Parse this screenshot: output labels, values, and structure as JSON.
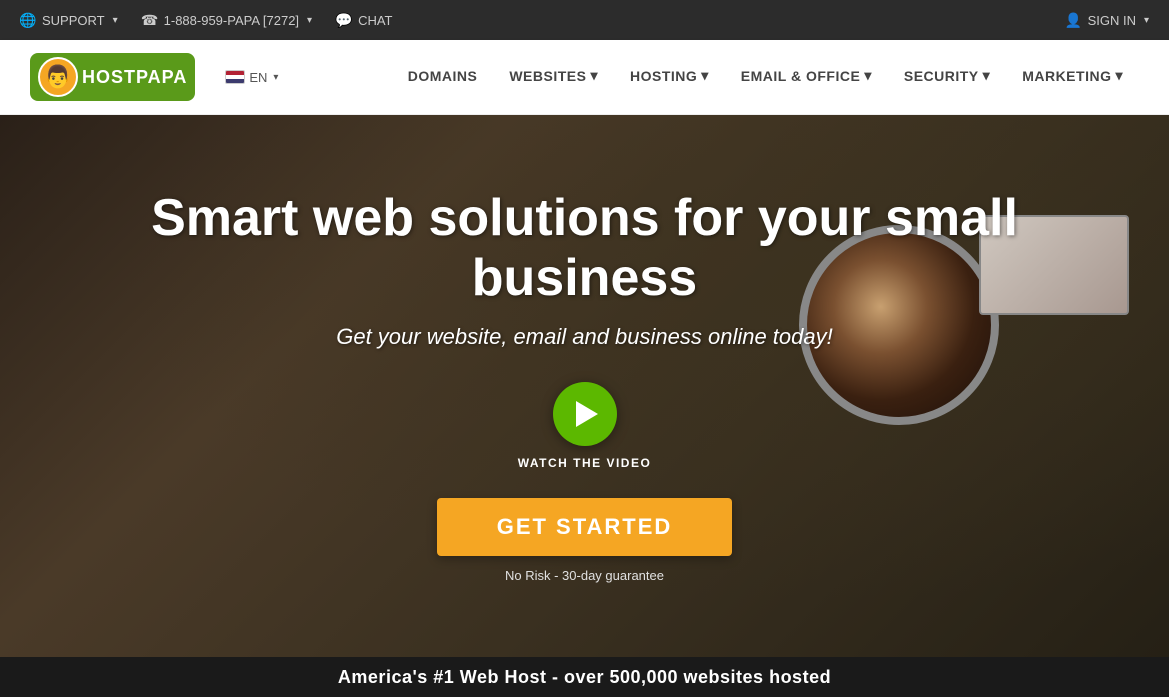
{
  "topbar": {
    "support_label": "SUPPORT",
    "phone_label": "1-888-959-PAPA [7272]",
    "chat_label": "CHAT",
    "signin_label": "SIGN IN"
  },
  "navbar": {
    "logo_text": "HOSTPAPA",
    "lang_label": "EN",
    "nav_items": [
      {
        "label": "DOMAINS",
        "has_arrow": false
      },
      {
        "label": "WEBSITES",
        "has_arrow": true
      },
      {
        "label": "HOSTING",
        "has_arrow": true
      },
      {
        "label": "EMAIL & OFFICE",
        "has_arrow": true
      },
      {
        "label": "SECURITY",
        "has_arrow": true
      },
      {
        "label": "MARKETING",
        "has_arrow": true
      }
    ]
  },
  "hero": {
    "title": "Smart web solutions for your small business",
    "subtitle": "Get your website, email and business online today!",
    "watch_label": "WATCH THE VIDEO",
    "cta_label": "GET STARTED",
    "guarantee_text": "No Risk - 30-day guarantee"
  },
  "bottom_banner": {
    "text": "America's #1 Web Host - over 500,000 websites hosted"
  }
}
